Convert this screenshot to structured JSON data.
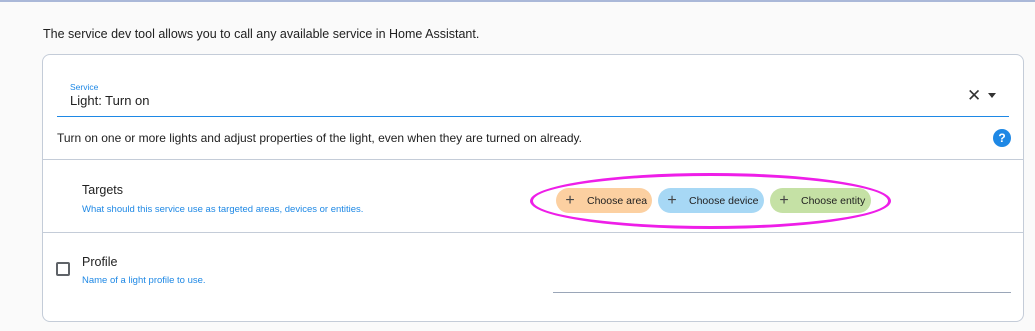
{
  "intro_text": "The service dev tool allows you to call any available service in Home Assistant.",
  "service": {
    "label": "Service",
    "value": "Light: Turn on",
    "clear_icon": "close-icon",
    "clear_glyph": "✕",
    "dropdown_icon": "arrow-drop-down-icon"
  },
  "description": "Turn on one or more lights and adjust properties of the light, even when they are turned on already.",
  "help": {
    "icon": "help-circle-icon",
    "glyph": "?"
  },
  "targets": {
    "title": "Targets",
    "description": "What should this service use as targeted areas, devices or entities.",
    "chips": [
      {
        "label": "Choose area",
        "color": "#fcd0a1",
        "icon": "plus-icon",
        "glyph": "+"
      },
      {
        "label": "Choose device",
        "color": "#a7d8f5",
        "icon": "plus-icon",
        "glyph": "+"
      },
      {
        "label": "Choose entity",
        "color": "#c5e1a5",
        "icon": "plus-icon",
        "glyph": "+"
      }
    ]
  },
  "profile": {
    "title": "Profile",
    "description": "Name of a light profile to use.",
    "checked": false,
    "value": ""
  },
  "colors": {
    "accent": "#1e88e5",
    "highlight": "#ee1ee8"
  }
}
